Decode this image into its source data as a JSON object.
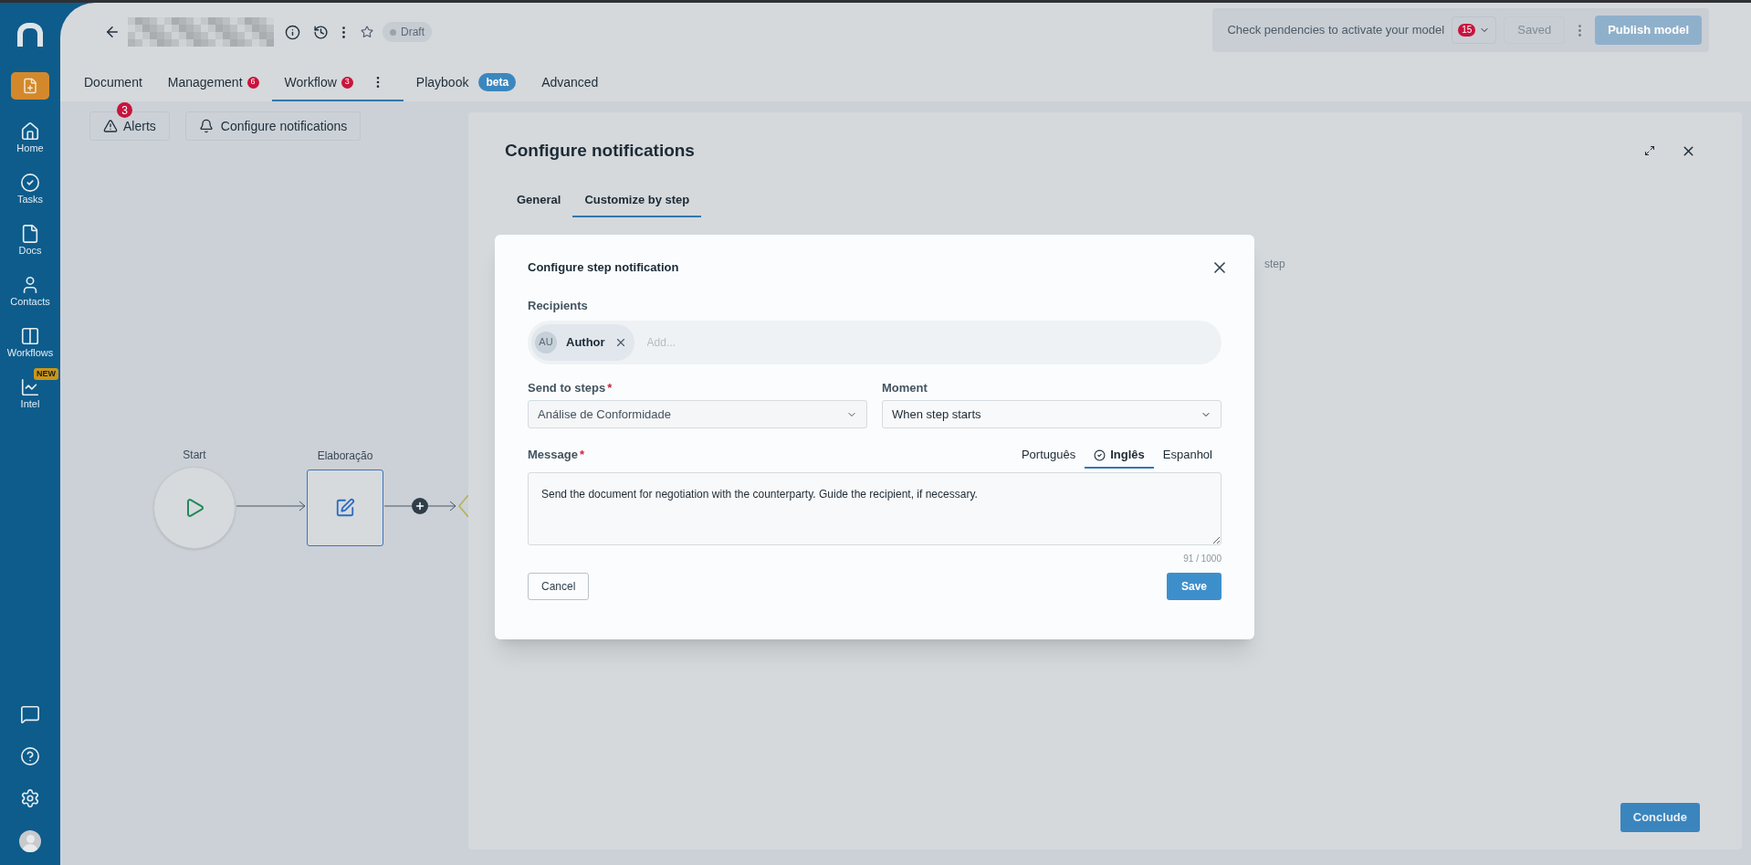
{
  "sidebar": {
    "items": [
      {
        "label": "Home"
      },
      {
        "label": "Tasks"
      },
      {
        "label": "Docs"
      },
      {
        "label": "Contacts"
      },
      {
        "label": "Workflows"
      },
      {
        "label": "Intel",
        "badge": "NEW"
      }
    ]
  },
  "header": {
    "status": "Draft",
    "pendencies": {
      "text": "Check pendencies to activate your model",
      "count": "15"
    },
    "saved_button": {
      "label": "Saved",
      "disabled": true
    },
    "publish_button": {
      "label": "Publish model",
      "disabled": true
    }
  },
  "tabs": [
    {
      "label": "Document",
      "selected": false
    },
    {
      "label": "Management",
      "count": "6",
      "selected": false
    },
    {
      "label": "Workflow",
      "count": "3",
      "selected": true,
      "menu": true
    },
    {
      "label": "Playbook",
      "tag": "beta",
      "selected": false
    },
    {
      "label": "Advanced",
      "selected": false
    }
  ],
  "toolbar": {
    "alerts": {
      "label": "Alerts",
      "count": "3"
    },
    "configure": {
      "label": "Configure notifications"
    }
  },
  "canvas": {
    "nodes": [
      {
        "kind": "start",
        "label": "Start"
      },
      {
        "kind": "task",
        "label": "Elaboração"
      }
    ]
  },
  "drawer": {
    "title": "Configure notifications",
    "tabs": [
      {
        "label": "General",
        "selected": false
      },
      {
        "label": "Customize by step",
        "selected": true
      }
    ],
    "hidden_text": "step",
    "conclude_button": "Conclude"
  },
  "modal": {
    "title": "Configure step notification",
    "recipients": {
      "label": "Recipients",
      "chips": [
        {
          "initials": "AU",
          "label": "Author"
        }
      ],
      "placeholder": "Add..."
    },
    "send_to_steps": {
      "label": "Send to steps",
      "required_mark": "*",
      "value": "Análise de Conformidade"
    },
    "moment": {
      "label": "Moment",
      "value": "When step starts"
    },
    "message": {
      "label": "Message",
      "required_mark": "*",
      "languages": [
        {
          "label": "Português",
          "selected": false
        },
        {
          "label": "Inglês",
          "selected": true
        },
        {
          "label": "Espanhol",
          "selected": false
        }
      ],
      "value": "Send the document for negotiation with the counterparty. Guide the recipient, if necessary.",
      "counter": "91 / 1000"
    },
    "cancel_button": "Cancel",
    "save_button": "Save"
  }
}
